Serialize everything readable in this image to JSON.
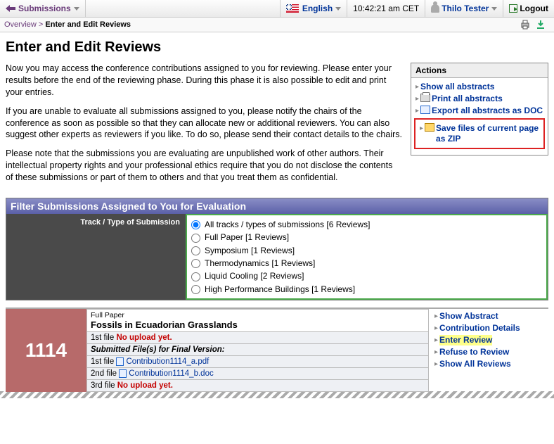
{
  "topbar": {
    "nav_back": "Submissions",
    "lang": "English",
    "clock": "10:42:21 am CET",
    "user": "Thilo Tester",
    "logout": "Logout"
  },
  "breadcrumb": {
    "root": "Overview",
    "sep": ">",
    "current": "Enter and Edit Reviews"
  },
  "page_title": "Enter and Edit Reviews",
  "intro": {
    "p1": "Now you may access the conference contributions assigned to you for reviewing. Please enter your results before the end of the reviewing phase. During this phase it is also possible to edit and print your entries.",
    "p2": "If you are unable to evaluate all submissions assigned to you, please notify the chairs of the conference as soon as possible so that they can allocate new or additional reviewers. You can also suggest other experts as reviewers if you like. To do so, please send their contact details to the chairs.",
    "p3": "Please note that the submissions you are evaluating are unpublished work of other authors. Their intellectual property rights and your professional ethics require that you do not disclose the contents of these submissions or part of them to others and that you treat them as confidential."
  },
  "actions": {
    "heading": "Actions",
    "items": [
      {
        "label": "Show all abstracts",
        "icon": null
      },
      {
        "label": "Print all abstracts",
        "icon": "print"
      },
      {
        "label": "Export all abstracts as DOC",
        "icon": "doc"
      }
    ],
    "highlight": {
      "label": "Save files of current page as ZIP",
      "icon": "zip"
    }
  },
  "filter": {
    "heading": "Filter Submissions Assigned to You for Evaluation",
    "label": "Track / Type of Submission",
    "options": [
      {
        "text": "All tracks / types of submissions   [6 Reviews]",
        "selected": true
      },
      {
        "text": "Full Paper   [1 Reviews]",
        "selected": false
      },
      {
        "text": "Symposium   [1 Reviews]",
        "selected": false
      },
      {
        "text": "Thermodynamics   [1 Reviews]",
        "selected": false
      },
      {
        "text": "Liquid Cooling   [2 Reviews]",
        "selected": false
      },
      {
        "text": "High Performance Buildings   [1 Reviews]",
        "selected": false
      }
    ]
  },
  "submission": {
    "id": "1114",
    "type": "Full Paper",
    "title": "Fossils in Ecuadorian Grasslands",
    "row_1st": {
      "label": "1st file",
      "value": "No upload yet."
    },
    "final_heading": "Submitted File(s) for Final Version:",
    "files": [
      {
        "label": "1st file",
        "name": "Contribution1114_a.pdf"
      },
      {
        "label": "2nd file",
        "name": "Contribution1114_b.doc"
      },
      {
        "label": "3rd file",
        "name": "No upload yet.",
        "none": true
      }
    ],
    "links": [
      {
        "label": "Show Abstract"
      },
      {
        "label": "Contribution Details"
      },
      {
        "label": "Enter Review",
        "hl": true
      },
      {
        "label": "Refuse to Review"
      },
      {
        "label": "Show All Reviews"
      }
    ]
  }
}
